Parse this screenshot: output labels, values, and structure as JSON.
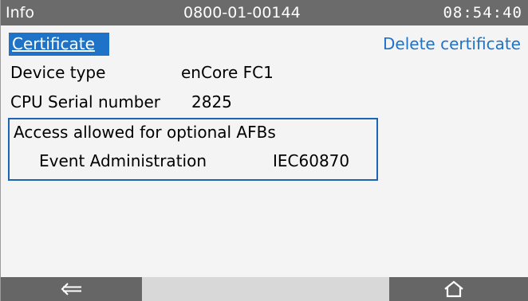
{
  "header": {
    "title": "Info",
    "serial": "0800-01-00144",
    "clock": "08:54:40"
  },
  "content": {
    "certificate_link": "Certificate",
    "delete_link": "Delete certificate",
    "rows": [
      {
        "label": "Device type",
        "value": "enCore FC1"
      },
      {
        "label": "CPU Serial number",
        "value": "2825"
      }
    ],
    "afb": {
      "title": "Access allowed for optional AFBs",
      "name": "Event Administration",
      "code": "IEC60870"
    }
  },
  "footer": {
    "back_icon": "arrow-left-icon",
    "home_icon": "home-icon"
  },
  "colors": {
    "header_bg": "#6b6b6b",
    "accent": "#1e73c8",
    "box_border": "#1e64b4",
    "footer_button": "#666666"
  }
}
